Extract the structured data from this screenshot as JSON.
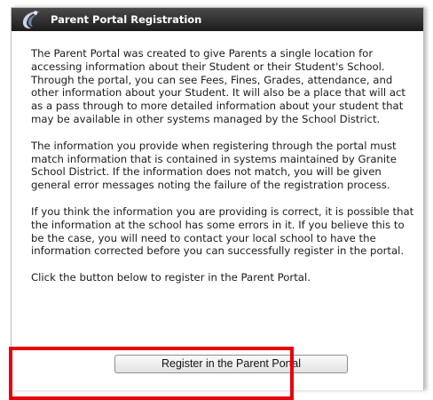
{
  "header": {
    "title": "Parent Portal Registration",
    "logo_icon": "swoosh-logo-icon"
  },
  "content": {
    "paragraphs": [
      "The Parent Portal was created to give Parents a single location for accessing information about their Student or their Student's School. Through the portal, you can see Fees, Fines, Grades, attendance, and other information about your Student. It will also be a place that will act as a pass through to more detailed information about your student that may be available in other systems managed by the School District.",
      "The information you provide when registering through the portal must match information that is contained in systems maintained by Granite School District. If the information does not match, you will be given general error messages noting the failure of the registration process.",
      "If you think the information you are providing is correct, it is possible that the information at the school has some errors in it. If you believe this to be the case, you will need to contact your local school to have the information corrected before you can successfully register in the portal.",
      "Click the button below to register in the Parent Portal."
    ]
  },
  "actions": {
    "register_label": "Register in the Parent Portal"
  },
  "colors": {
    "title_bar": "#2e2e2e",
    "highlight": "#e8000b",
    "logo_light": "#cfd8e6",
    "logo_mid": "#6f86ad"
  }
}
